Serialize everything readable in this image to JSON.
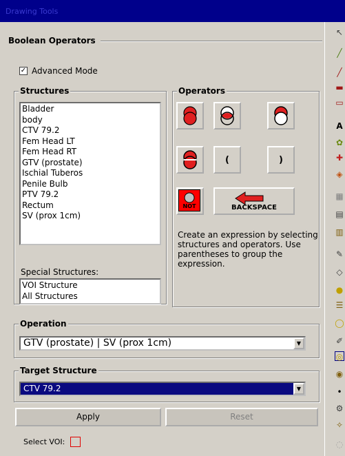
{
  "window": {
    "title": "Drawing Tools"
  },
  "header": {
    "title": "Boolean Operators"
  },
  "advanced_mode": {
    "label": "Advanced Mode",
    "checked": true
  },
  "structures": {
    "title": "Structures",
    "items": [
      "Bladder",
      "body",
      "CTV 79.2",
      "Fem Head LT",
      "Fem Head RT",
      "GTV (prostate)",
      "Ischial Tuberos",
      "Penile Bulb",
      "PTV 79.2",
      "Rectum",
      "SV (prox 1cm)"
    ]
  },
  "special_structures": {
    "label": "Special Structures:",
    "items": [
      "VOI Structure",
      "All Structures"
    ]
  },
  "operators": {
    "title": "Operators",
    "open_paren": "(",
    "close_paren": ")",
    "not_label": "NOT",
    "backspace_label": "BACKSPACE",
    "help": "Create an expression by selecting structures and operators. Use parentheses to group the expression."
  },
  "operation": {
    "title": "Operation",
    "value": "GTV (prostate) | SV (prox 1cm)"
  },
  "target": {
    "title": "Target Structure",
    "value": "CTV 79.2"
  },
  "buttons": {
    "apply": "Apply",
    "reset": "Reset"
  },
  "voi": {
    "label": "Select VOI:"
  },
  "toolbar_icons": [
    "arrow-icon",
    "line-icon",
    "pen-icon",
    "brush-icon",
    "rectangle-icon",
    "text-icon",
    "leaf-icon",
    "nudge-icon",
    "paint-icon",
    "grid-icon",
    "ruler-icon",
    "structure-icon",
    "pencil-icon",
    "eraser-icon",
    "dot-icon",
    "list-icon",
    "ring-icon",
    "wand-icon",
    "boolean-icon",
    "stack-icon",
    "point-icon",
    "settings-icon",
    "magic-icon",
    "extra-icon"
  ],
  "colors": {
    "title_bar": "#00008b",
    "selection": "#0a0a80",
    "operator_red": "#e02020",
    "panel": "#d4d0c8"
  }
}
